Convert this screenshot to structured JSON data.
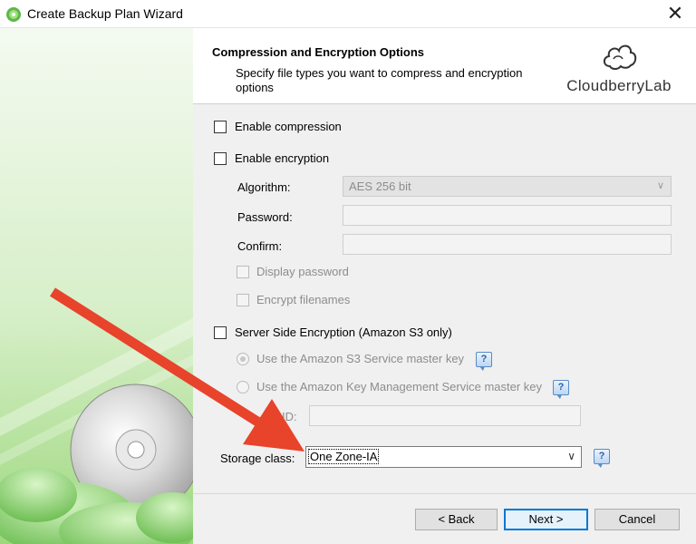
{
  "window": {
    "title": "Create Backup Plan Wizard",
    "close_glyph": "✕"
  },
  "header": {
    "title": "Compression and Encryption Options",
    "subtitle": "Specify file types you want to compress and encryption options",
    "logo_text": "CloudberryLab"
  },
  "options": {
    "enable_compression": "Enable compression",
    "enable_encryption": "Enable encryption",
    "algorithm_label": "Algorithm:",
    "algorithm_value": "AES 256 bit",
    "password_label": "Password:",
    "confirm_label": "Confirm:",
    "display_password": "Display password",
    "encrypt_filenames": "Encrypt filenames",
    "sse": "Server Side Encryption (Amazon S3 only)",
    "sse_master_key": "Use the Amazon S3 Service master key",
    "kms_master_key": "Use the Amazon Key Management Service master key",
    "kms_id_label": "ID:",
    "storage_class_label": "Storage class:",
    "storage_class_value": "One Zone-IA",
    "help_glyph": "?"
  },
  "buttons": {
    "back": "< Back",
    "next": "Next >",
    "cancel": "Cancel"
  },
  "colors": {
    "annotation_arrow": "#e8432b",
    "default_button_border": "#0078d7",
    "art_green": "#6cc04a"
  },
  "icons": {
    "app": "cloudberry-backup-icon",
    "logo": "cloud-icon",
    "help": "help-icon",
    "chevron": "chevron-down-icon",
    "art": "cd-disc-icon"
  }
}
